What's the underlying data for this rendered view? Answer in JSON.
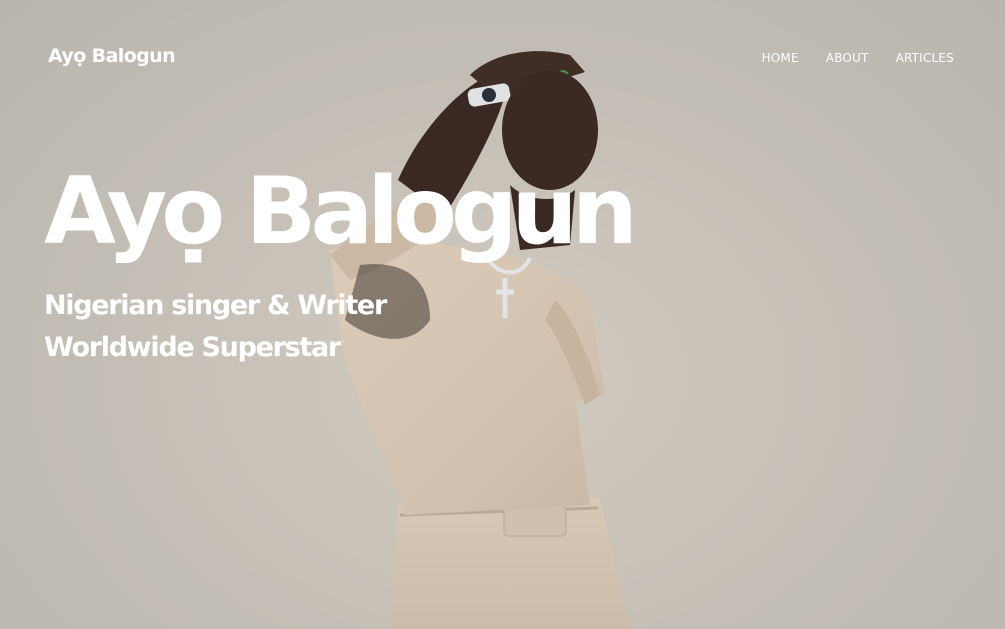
{
  "header": {
    "brand": "Ayọ Balogun",
    "nav": [
      {
        "label": "HOME"
      },
      {
        "label": "ABOUT"
      },
      {
        "label": "ARTICLES"
      }
    ]
  },
  "hero": {
    "title": "Ayọ Balogun",
    "subtitle_line1": "Nigerian singer & Writer",
    "subtitle_line2": "Worldwide Superstar",
    "photo": "man-in-beige-outfit-hand-on-forehead"
  },
  "colors": {
    "text": "#ffffff",
    "background": "#c9c4bc",
    "outfit": "#d8c8b6",
    "skin": "#3b2a24"
  }
}
